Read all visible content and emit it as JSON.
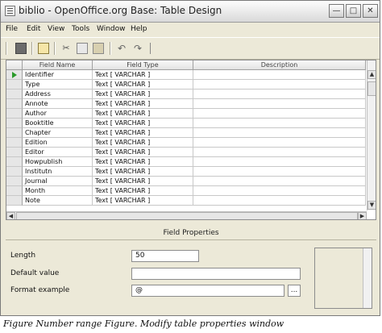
{
  "window": {
    "title": "biblio - OpenOffice.org Base: Table Design"
  },
  "menu": [
    "File",
    "Edit",
    "View",
    "Tools",
    "Window",
    "Help"
  ],
  "grid": {
    "headers": [
      "Field Name",
      "Field Type",
      "Description"
    ],
    "rows": [
      {
        "name": "Identifier",
        "type": "Text [ VARCHAR ]",
        "current": true
      },
      {
        "name": "Type",
        "type": "Text [ VARCHAR ]"
      },
      {
        "name": "Address",
        "type": "Text [ VARCHAR ]"
      },
      {
        "name": "Annote",
        "type": "Text [ VARCHAR ]"
      },
      {
        "name": "Author",
        "type": "Text [ VARCHAR ]"
      },
      {
        "name": "Booktitle",
        "type": "Text [ VARCHAR ]"
      },
      {
        "name": "Chapter",
        "type": "Text [ VARCHAR ]"
      },
      {
        "name": "Edition",
        "type": "Text [ VARCHAR ]"
      },
      {
        "name": "Editor",
        "type": "Text [ VARCHAR ]"
      },
      {
        "name": "Howpublish",
        "type": "Text [ VARCHAR ]"
      },
      {
        "name": "Institutn",
        "type": "Text [ VARCHAR ]"
      },
      {
        "name": "Journal",
        "type": "Text [ VARCHAR ]"
      },
      {
        "name": "Month",
        "type": "Text [ VARCHAR ]"
      },
      {
        "name": "Note",
        "type": "Text [ VARCHAR ]"
      }
    ]
  },
  "field_properties": {
    "title": "Field Properties",
    "length_label": "Length",
    "length_value": "50",
    "default_label": "Default value",
    "default_value": "",
    "format_label": "Format example",
    "format_value": "@",
    "format_button": "..."
  },
  "caption": "Figure Number range Figure. Modify table properties window",
  "icons": [
    "app-icon",
    "minimize-icon",
    "maximize-icon",
    "close-icon",
    "save-icon",
    "edit-icon",
    "cut-icon",
    "copy-icon",
    "paste-icon",
    "undo-icon",
    "redo-icon"
  ]
}
